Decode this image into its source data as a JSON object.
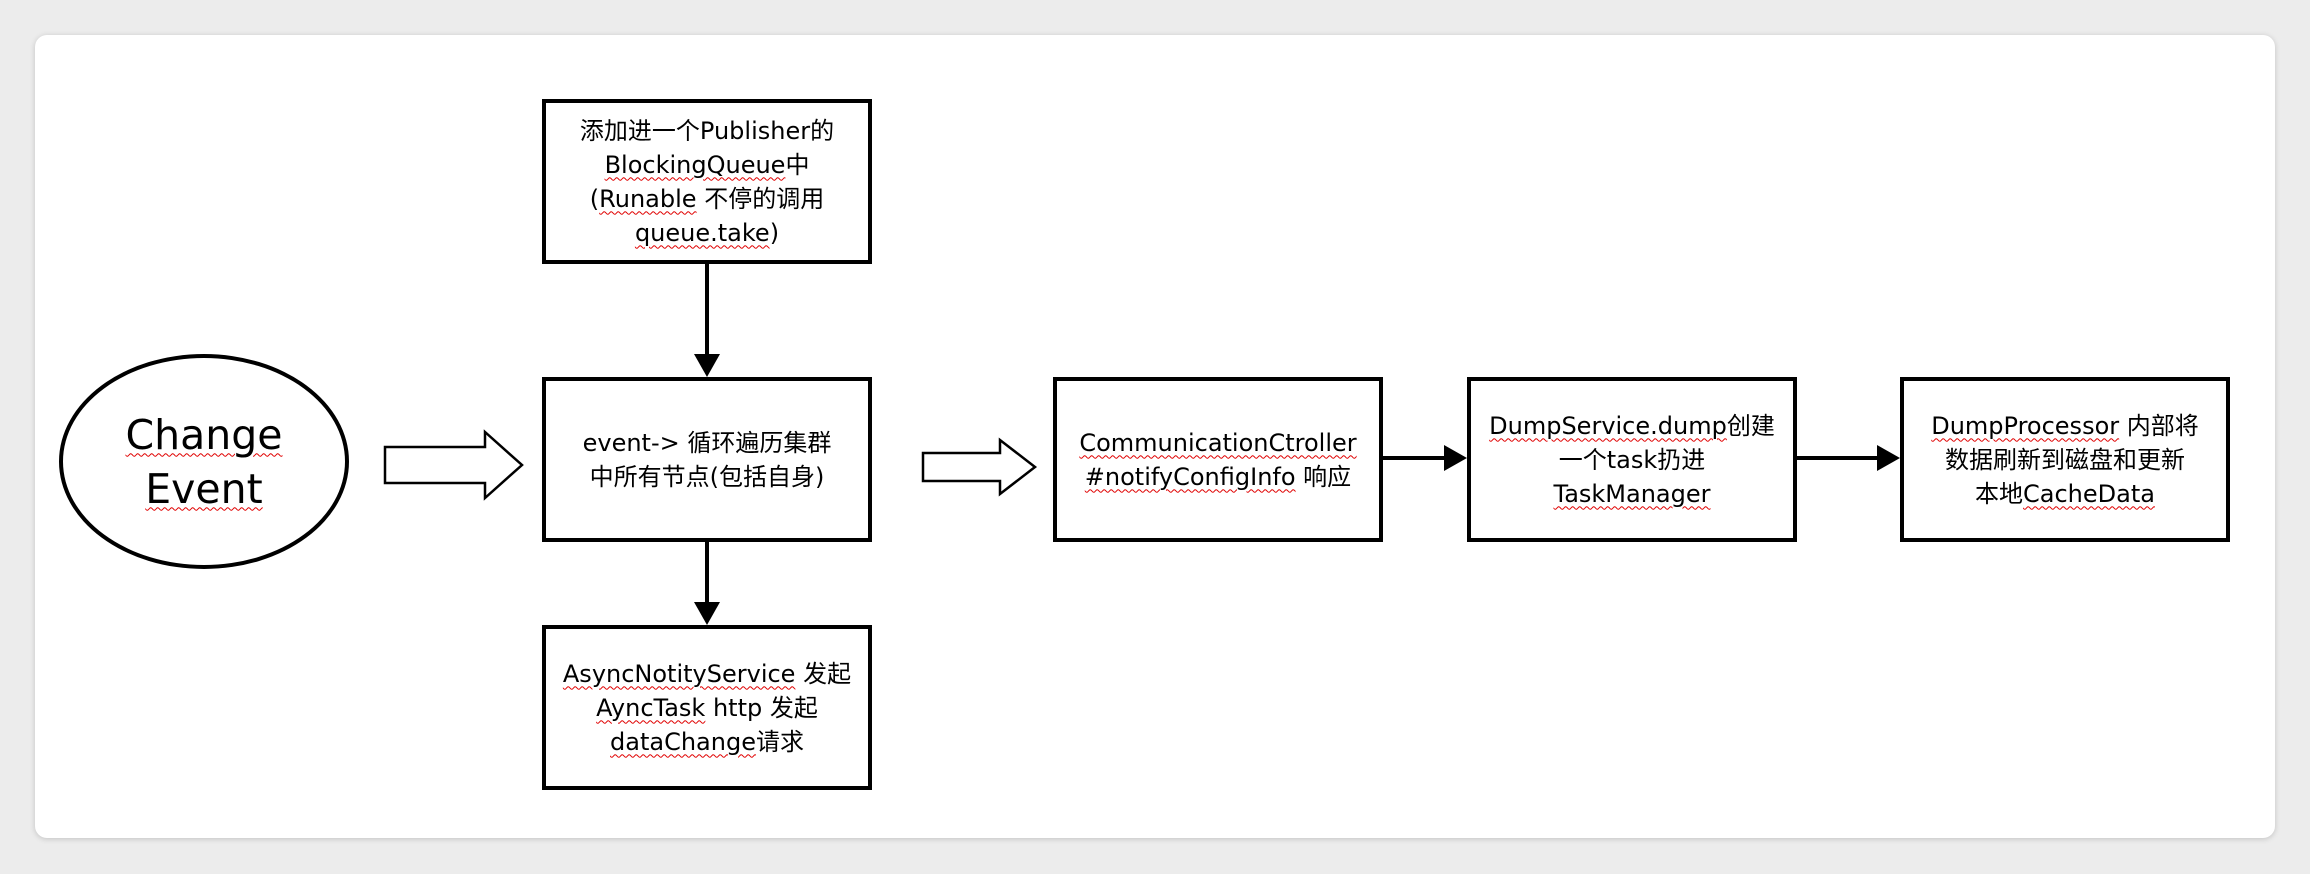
{
  "nodes": {
    "start": {
      "lines": [
        [
          {
            "t": "Change",
            "s": true
          }
        ],
        [
          {
            "t": "Event",
            "s": true
          }
        ]
      ]
    },
    "publisher": {
      "lines": [
        [
          {
            "t": "添加进一个Publisher的",
            "s": false
          }
        ],
        [
          {
            "t": "BlockingQueue",
            "s": true
          },
          {
            "t": "中",
            "s": false
          }
        ],
        [
          {
            "t": "(",
            "s": false
          },
          {
            "t": "Runable",
            "s": true
          },
          {
            "t": " 不停的调用",
            "s": false
          }
        ],
        [
          {
            "t": "queue.take",
            "s": true
          },
          {
            "t": ")",
            "s": false
          }
        ]
      ]
    },
    "loop": {
      "lines": [
        [
          {
            "t": "event-> 循环遍历集群",
            "s": false
          }
        ],
        [
          {
            "t": "中所有节点(包括自身)",
            "s": false
          }
        ]
      ]
    },
    "async": {
      "lines": [
        [
          {
            "t": "AsyncNotityService",
            "s": true
          },
          {
            "t": " 发起",
            "s": false
          }
        ],
        [
          {
            "t": "AyncTask",
            "s": true
          },
          {
            "t": " http 发起",
            "s": false
          }
        ],
        [
          {
            "t": "dataChange",
            "s": true
          },
          {
            "t": "请求",
            "s": false
          }
        ]
      ]
    },
    "controller": {
      "lines": [
        [
          {
            "t": "CommunicationCtroller",
            "s": true
          }
        ],
        [
          {
            "t": "#notifyConfigInfo",
            "s": true
          },
          {
            "t": " 响应",
            "s": false
          }
        ]
      ]
    },
    "dump": {
      "lines": [
        [
          {
            "t": "DumpService.dump",
            "s": true
          },
          {
            "t": "创建",
            "s": false
          }
        ],
        [
          {
            "t": "一个task扔进",
            "s": false
          }
        ],
        [
          {
            "t": "TaskManager",
            "s": true
          }
        ]
      ]
    },
    "processor": {
      "lines": [
        [
          {
            "t": "DumpProcessor",
            "s": true
          },
          {
            "t": " 内部将",
            "s": false
          }
        ],
        [
          {
            "t": "数据刷新到磁盘和更新",
            "s": false
          }
        ],
        [
          {
            "t": "本地",
            "s": false
          },
          {
            "t": "CacheData",
            "s": true
          }
        ]
      ]
    }
  }
}
